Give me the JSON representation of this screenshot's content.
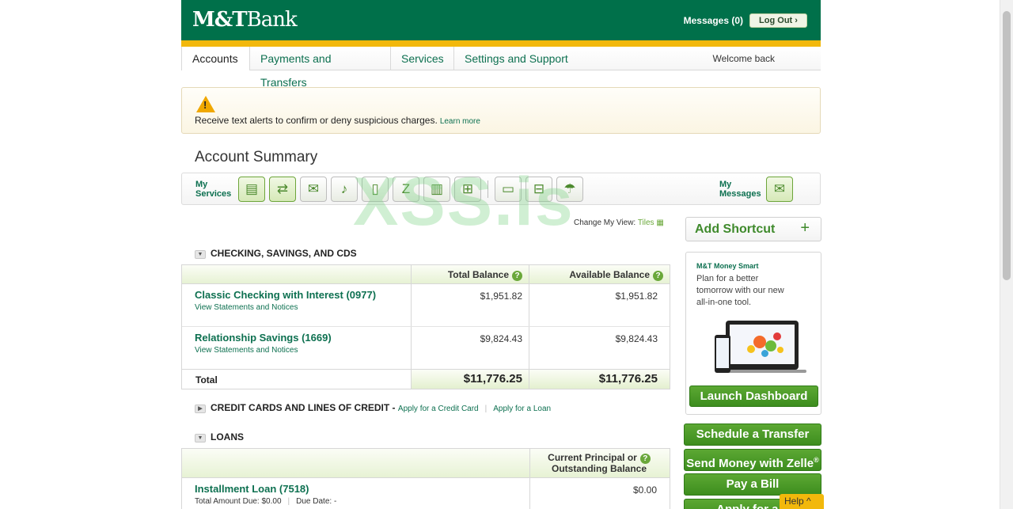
{
  "brand": {
    "name_bold": "M&T",
    "name_light": "Bank"
  },
  "header": {
    "messages": "Messages (0)",
    "logout": "Log Out"
  },
  "nav": {
    "tabs": [
      "Accounts",
      "Payments and Transfers",
      "Services",
      "Settings and Support"
    ],
    "welcome": "Welcome back"
  },
  "alert": {
    "message": "Receive text alerts to confirm or deny suspicious charges.",
    "link": "Learn more"
  },
  "summary": {
    "title": "Account Summary"
  },
  "services_bar": {
    "my_services": [
      "My",
      "Services"
    ],
    "my_messages": [
      "My",
      "Messages"
    ],
    "icons": [
      "statements-icon",
      "transfer-icon",
      "bill-pay-icon",
      "alerts-bell-icon",
      "mobile-icon",
      "zelle-icon",
      "investing-chart-icon",
      "gift-icon",
      "checks-icon",
      "cart-icon",
      "umbrella-icon"
    ]
  },
  "change_view": {
    "label": "Change My View:",
    "value": "Tiles"
  },
  "checking": {
    "title": "CHECKING, SAVINGS, AND CDS",
    "col_total": "Total Balance",
    "col_available": "Available Balance",
    "rows": [
      {
        "name": "Classic Checking with Interest (0977)",
        "sub": "View Statements and Notices",
        "total": "$1,951.82",
        "available": "$1,951.82"
      },
      {
        "name": "Relationship Savings (1669)",
        "sub": "View Statements and Notices",
        "total": "$9,824.43",
        "available": "$9,824.43"
      }
    ],
    "total_label": "Total",
    "total_balance": "$11,776.25",
    "total_available": "$11,776.25"
  },
  "credit": {
    "title": "CREDIT CARDS AND LINES OF CREDIT -",
    "link1": "Apply for a Credit Card",
    "link2": "Apply for a Loan"
  },
  "loans": {
    "title": "LOANS",
    "col_principal_1": "Current Principal or",
    "col_principal_2": "Outstanding Balance",
    "rows": [
      {
        "name": "Installment Loan (7518)",
        "amount_due": "Total Amount Due: $0.00",
        "due_date": "Due Date: -",
        "balance": "$0.00"
      }
    ]
  },
  "sidebar": {
    "add_shortcut": "Add Shortcut",
    "promo_heading": "M&T Money Smart",
    "promo_body": "Plan for a better tomorrow with our new all-in-one tool.",
    "promo_button": "Launch Dashboard",
    "actions": [
      "Schedule a Transfer",
      "Send Money with Zelle",
      "Pay a Bill",
      "Apply for a L"
    ],
    "zelle_mark": "®"
  },
  "help": "Help",
  "watermark": "XSS.is",
  "colors": {
    "brand_green": "#00704a",
    "gold": "#f2b80c",
    "button_green": "#4a9a28"
  }
}
